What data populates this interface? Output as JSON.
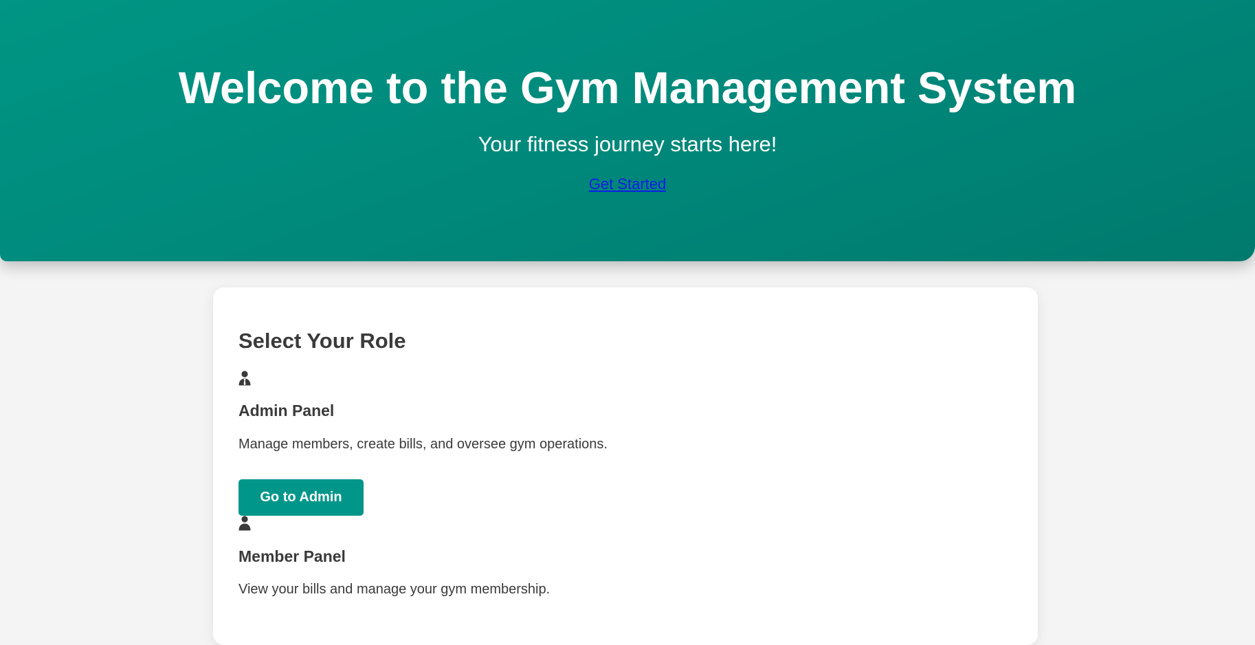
{
  "hero": {
    "title": "Welcome to the Gym Management System",
    "subtitle": "Your fitness journey starts here!",
    "cta_link": "Get Started",
    "background_color": "#009584",
    "link_color": "#0b1ee6"
  },
  "roles_section": {
    "heading": "Select Your Role",
    "roles": [
      {
        "icon": "admin-user-tie-icon",
        "title": "Admin Panel",
        "description": "Manage members, create bills, and oversee gym operations.",
        "button_label": "Go to Admin"
      },
      {
        "icon": "user-icon",
        "title": "Member Panel",
        "description": "View your bills and manage your gym membership."
      }
    ]
  },
  "colors": {
    "accent": "#00968a",
    "text": "#3a3a3a",
    "page_background": "#f4f4f4"
  }
}
